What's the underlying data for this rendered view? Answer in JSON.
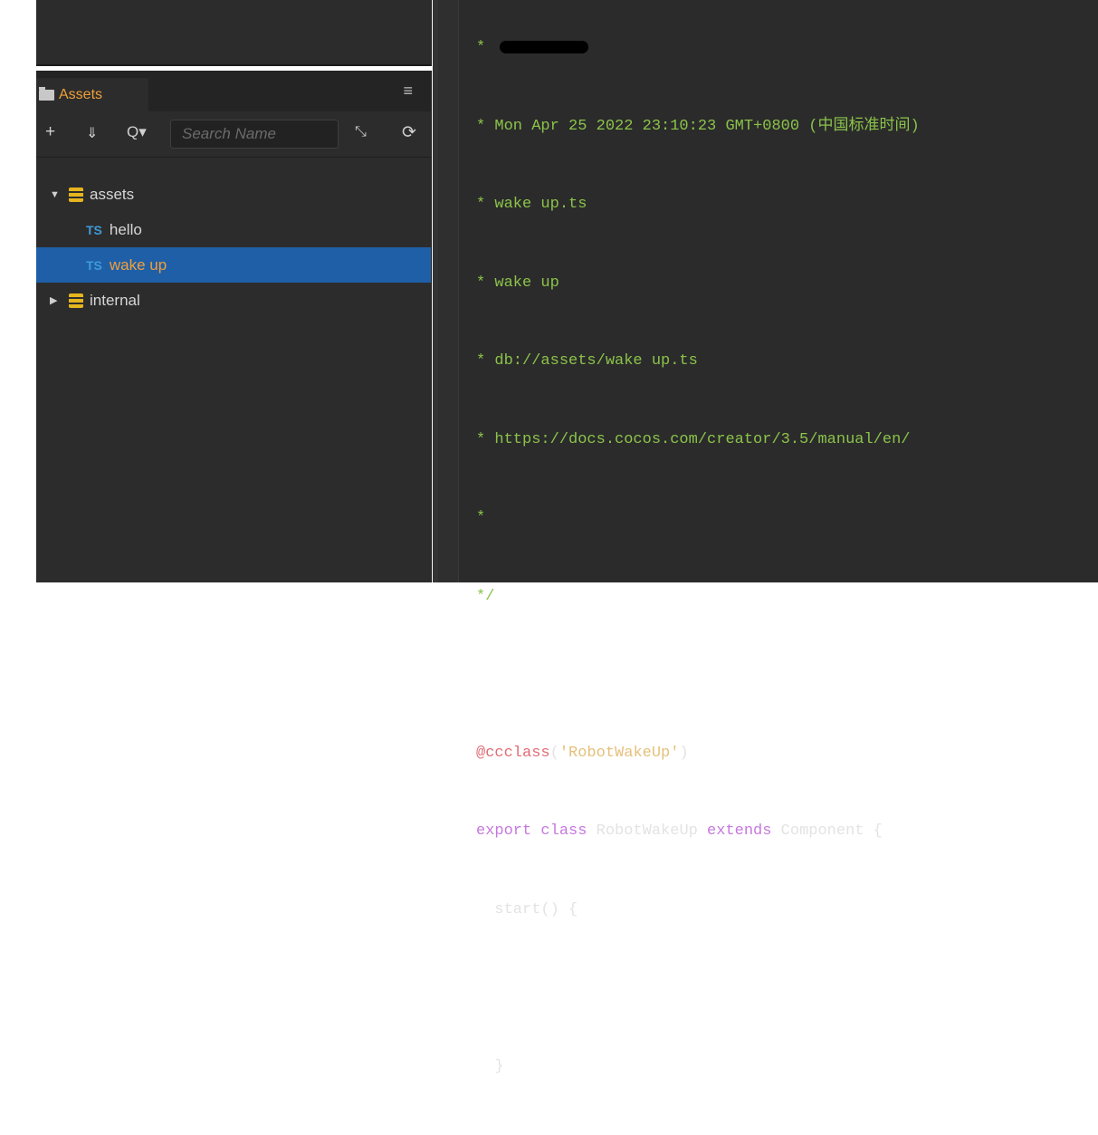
{
  "assets_panel": {
    "tab_label": "Assets",
    "menu_icon": "hamburger-menu-icon",
    "toolbar": {
      "add_icon": "+",
      "sort_icon": "⇓",
      "search_type_icon": "Q▾",
      "search_placeholder": "Search Name",
      "collapse_icon": "⤡",
      "refresh_icon": "⟳"
    },
    "tree": [
      {
        "label": "assets",
        "expanded": true,
        "type": "database"
      },
      {
        "label": "hello",
        "type": "ts-file",
        "badge": "TS"
      },
      {
        "label": "wake up",
        "type": "ts-file",
        "badge": "TS",
        "selected": true
      },
      {
        "label": "internal",
        "expanded": false,
        "type": "database"
      }
    ]
  },
  "editor": {
    "lines": [
      {
        "text": "* ",
        "kind": "comment",
        "redacted": true
      },
      {
        "text": "* Mon Apr 25 2022 23:10:23 GMT+0800 (中国标准时间)",
        "kind": "comment"
      },
      {
        "text": "* wake up.ts",
        "kind": "comment"
      },
      {
        "text": "* wake up",
        "kind": "comment"
      },
      {
        "text": "* db://assets/wake up.ts",
        "kind": "comment"
      },
      {
        "text": "* https://docs.cocos.com/creator/3.5/manual/en/",
        "kind": "comment"
      },
      {
        "text": "*",
        "kind": "comment"
      },
      {
        "text": "*/",
        "kind": "comment"
      },
      {
        "text": "",
        "kind": "blank"
      },
      {
        "decorator": "@ccclass",
        "open": "(",
        "string": "'RobotWakeUp'",
        "close": ")"
      },
      {
        "kw1": "export class",
        "name": " RobotWakeUp ",
        "kw2": "extends",
        "rest": " Component {"
      },
      {
        "text": "  start() {",
        "kind": "plain"
      },
      {
        "text": "",
        "kind": "blank"
      },
      {
        "text": "  }",
        "kind": "plain"
      }
    ]
  },
  "colors": {
    "panel_bg": "#2c2c2c",
    "editor_bg": "#2b2b2b",
    "selection": "#1f5fa8",
    "accent_orange": "#f0a03a",
    "comment_green": "#8bc34a",
    "keyword_purple": "#c678dd"
  }
}
